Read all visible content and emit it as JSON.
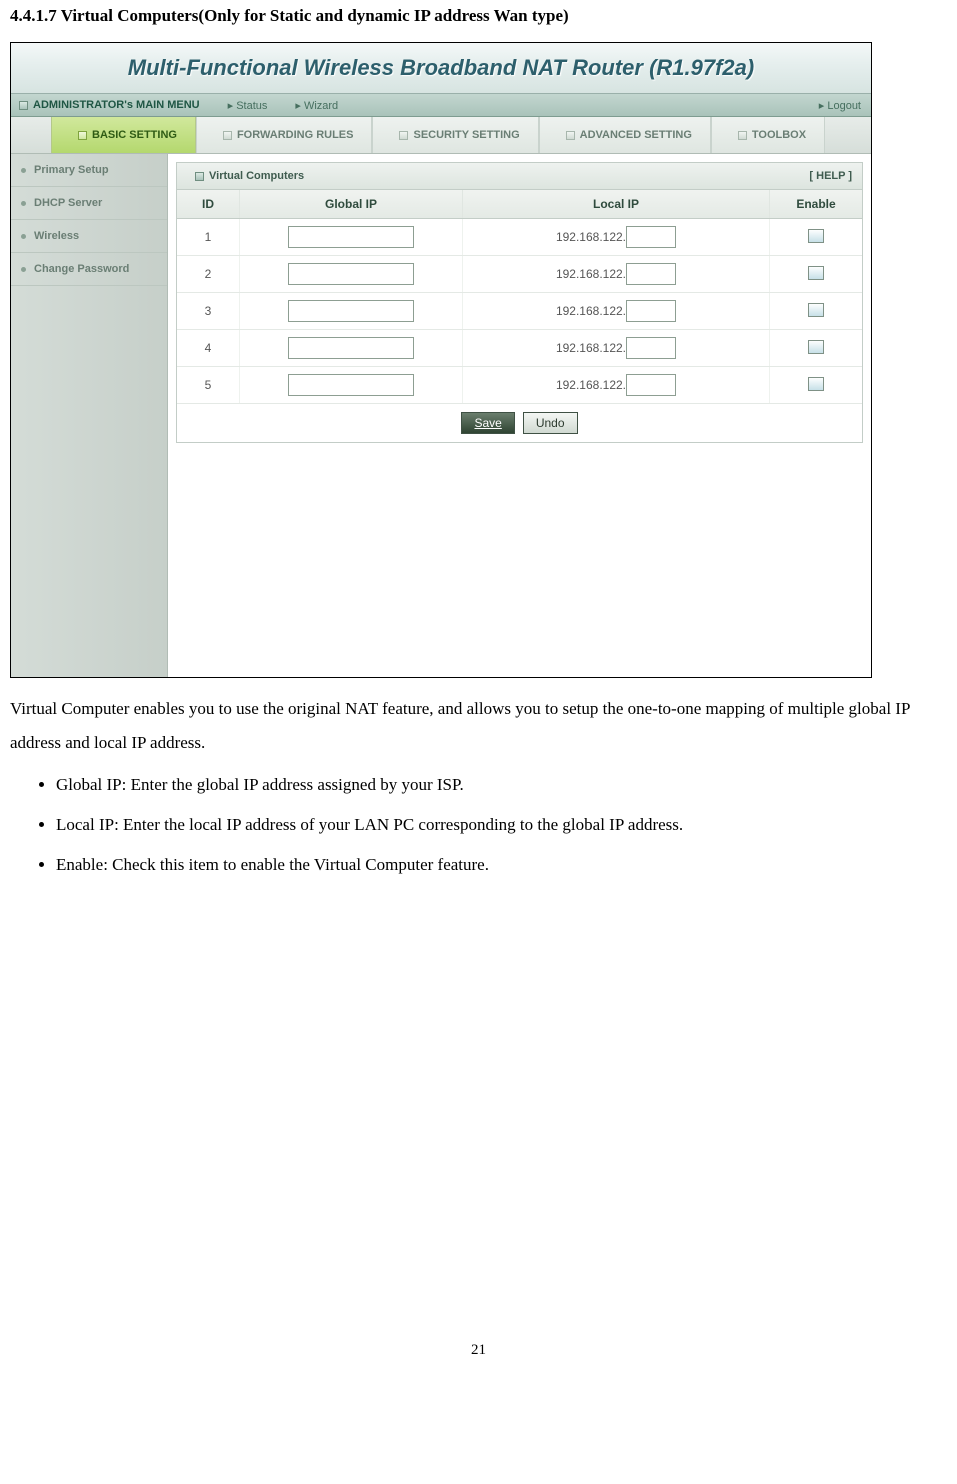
{
  "doc": {
    "section_heading": "4.4.1.7 Virtual Computers(Only for Static and dynamic IP address Wan type)",
    "intro": "Virtual Computer enables you to use the original NAT feature, and allows you to setup the one-to-one mapping of multiple global IP address and local IP address.",
    "bullets": [
      "Global IP: Enter the global IP address assigned by your ISP.",
      "Local IP: Enter the local IP address of your LAN PC corresponding to the global IP address.",
      "Enable: Check this item to enable the Virtual Computer feature."
    ],
    "page_number": "21"
  },
  "router": {
    "title": "Multi-Functional Wireless Broadband NAT Router (R1.97f2a)",
    "menubar": {
      "admin": "ADMINISTRATOR's MAIN MENU",
      "status": "Status",
      "wizard": "Wizard",
      "logout": "Logout"
    },
    "tabs": {
      "basic": "BASIC SETTING",
      "forwarding": "FORWARDING RULES",
      "security": "SECURITY SETTING",
      "advanced": "ADVANCED SETTING",
      "toolbox": "TOOLBOX"
    },
    "sidebar": {
      "items": [
        "Primary Setup",
        "DHCP Server",
        "Wireless",
        "Change Password"
      ]
    },
    "panel": {
      "title": "Virtual Computers",
      "help": "[ HELP ]",
      "headers": {
        "id": "ID",
        "global": "Global IP",
        "local": "Local IP",
        "enable": "Enable"
      },
      "local_prefix": "192.168.122.",
      "rows": [
        {
          "id": "1"
        },
        {
          "id": "2"
        },
        {
          "id": "3"
        },
        {
          "id": "4"
        },
        {
          "id": "5"
        }
      ],
      "buttons": {
        "save": "Save",
        "undo": "Undo"
      }
    }
  }
}
